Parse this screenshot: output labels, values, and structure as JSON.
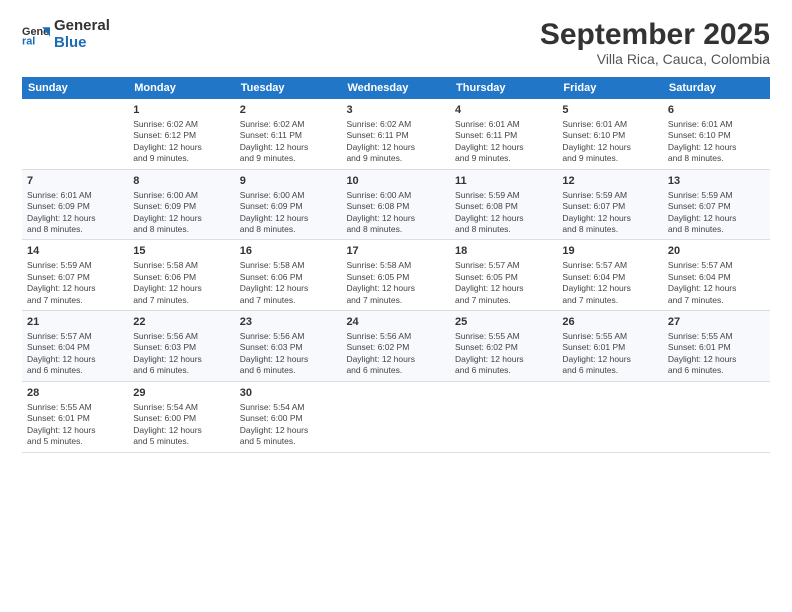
{
  "logo": {
    "text_general": "General",
    "text_blue": "Blue"
  },
  "title": "September 2025",
  "subtitle": "Villa Rica, Cauca, Colombia",
  "days_of_week": [
    "Sunday",
    "Monday",
    "Tuesday",
    "Wednesday",
    "Thursday",
    "Friday",
    "Saturday"
  ],
  "weeks": [
    [
      {
        "day": "",
        "info": ""
      },
      {
        "day": "1",
        "info": "Sunrise: 6:02 AM\nSunset: 6:12 PM\nDaylight: 12 hours\nand 9 minutes."
      },
      {
        "day": "2",
        "info": "Sunrise: 6:02 AM\nSunset: 6:11 PM\nDaylight: 12 hours\nand 9 minutes."
      },
      {
        "day": "3",
        "info": "Sunrise: 6:02 AM\nSunset: 6:11 PM\nDaylight: 12 hours\nand 9 minutes."
      },
      {
        "day": "4",
        "info": "Sunrise: 6:01 AM\nSunset: 6:11 PM\nDaylight: 12 hours\nand 9 minutes."
      },
      {
        "day": "5",
        "info": "Sunrise: 6:01 AM\nSunset: 6:10 PM\nDaylight: 12 hours\nand 9 minutes."
      },
      {
        "day": "6",
        "info": "Sunrise: 6:01 AM\nSunset: 6:10 PM\nDaylight: 12 hours\nand 8 minutes."
      }
    ],
    [
      {
        "day": "7",
        "info": "Sunrise: 6:01 AM\nSunset: 6:09 PM\nDaylight: 12 hours\nand 8 minutes."
      },
      {
        "day": "8",
        "info": "Sunrise: 6:00 AM\nSunset: 6:09 PM\nDaylight: 12 hours\nand 8 minutes."
      },
      {
        "day": "9",
        "info": "Sunrise: 6:00 AM\nSunset: 6:09 PM\nDaylight: 12 hours\nand 8 minutes."
      },
      {
        "day": "10",
        "info": "Sunrise: 6:00 AM\nSunset: 6:08 PM\nDaylight: 12 hours\nand 8 minutes."
      },
      {
        "day": "11",
        "info": "Sunrise: 5:59 AM\nSunset: 6:08 PM\nDaylight: 12 hours\nand 8 minutes."
      },
      {
        "day": "12",
        "info": "Sunrise: 5:59 AM\nSunset: 6:07 PM\nDaylight: 12 hours\nand 8 minutes."
      },
      {
        "day": "13",
        "info": "Sunrise: 5:59 AM\nSunset: 6:07 PM\nDaylight: 12 hours\nand 8 minutes."
      }
    ],
    [
      {
        "day": "14",
        "info": "Sunrise: 5:59 AM\nSunset: 6:07 PM\nDaylight: 12 hours\nand 7 minutes."
      },
      {
        "day": "15",
        "info": "Sunrise: 5:58 AM\nSunset: 6:06 PM\nDaylight: 12 hours\nand 7 minutes."
      },
      {
        "day": "16",
        "info": "Sunrise: 5:58 AM\nSunset: 6:06 PM\nDaylight: 12 hours\nand 7 minutes."
      },
      {
        "day": "17",
        "info": "Sunrise: 5:58 AM\nSunset: 6:05 PM\nDaylight: 12 hours\nand 7 minutes."
      },
      {
        "day": "18",
        "info": "Sunrise: 5:57 AM\nSunset: 6:05 PM\nDaylight: 12 hours\nand 7 minutes."
      },
      {
        "day": "19",
        "info": "Sunrise: 5:57 AM\nSunset: 6:04 PM\nDaylight: 12 hours\nand 7 minutes."
      },
      {
        "day": "20",
        "info": "Sunrise: 5:57 AM\nSunset: 6:04 PM\nDaylight: 12 hours\nand 7 minutes."
      }
    ],
    [
      {
        "day": "21",
        "info": "Sunrise: 5:57 AM\nSunset: 6:04 PM\nDaylight: 12 hours\nand 6 minutes."
      },
      {
        "day": "22",
        "info": "Sunrise: 5:56 AM\nSunset: 6:03 PM\nDaylight: 12 hours\nand 6 minutes."
      },
      {
        "day": "23",
        "info": "Sunrise: 5:56 AM\nSunset: 6:03 PM\nDaylight: 12 hours\nand 6 minutes."
      },
      {
        "day": "24",
        "info": "Sunrise: 5:56 AM\nSunset: 6:02 PM\nDaylight: 12 hours\nand 6 minutes."
      },
      {
        "day": "25",
        "info": "Sunrise: 5:55 AM\nSunset: 6:02 PM\nDaylight: 12 hours\nand 6 minutes."
      },
      {
        "day": "26",
        "info": "Sunrise: 5:55 AM\nSunset: 6:01 PM\nDaylight: 12 hours\nand 6 minutes."
      },
      {
        "day": "27",
        "info": "Sunrise: 5:55 AM\nSunset: 6:01 PM\nDaylight: 12 hours\nand 6 minutes."
      }
    ],
    [
      {
        "day": "28",
        "info": "Sunrise: 5:55 AM\nSunset: 6:01 PM\nDaylight: 12 hours\nand 5 minutes."
      },
      {
        "day": "29",
        "info": "Sunrise: 5:54 AM\nSunset: 6:00 PM\nDaylight: 12 hours\nand 5 minutes."
      },
      {
        "day": "30",
        "info": "Sunrise: 5:54 AM\nSunset: 6:00 PM\nDaylight: 12 hours\nand 5 minutes."
      },
      {
        "day": "",
        "info": ""
      },
      {
        "day": "",
        "info": ""
      },
      {
        "day": "",
        "info": ""
      },
      {
        "day": "",
        "info": ""
      }
    ]
  ]
}
